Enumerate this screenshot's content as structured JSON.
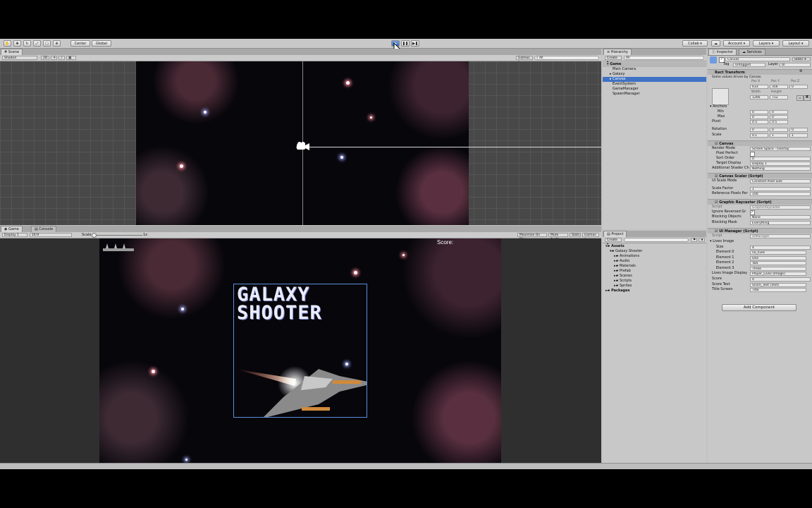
{
  "toolbar": {
    "pivot": "Center",
    "space": "Global",
    "collab": "Collab ▾",
    "account": "Account ▾",
    "layers": "Layers ▾",
    "layout": "Layout ▾"
  },
  "scene": {
    "tab": "Scene",
    "shading": "Shaded",
    "mode_2d": "2D",
    "gizmos": "Gizmos ▾",
    "search": "All"
  },
  "game": {
    "tabs": [
      "Game",
      "Console"
    ],
    "display": "Display 1",
    "aspect": "16:9",
    "scale_label": "Scale",
    "scale_value": "1x",
    "options": [
      "Maximize On Play",
      "Mute Audio",
      "Stats",
      "Gizmos ▾"
    ],
    "score_label": "Score:",
    "title_line1": "GALAXY",
    "title_line2": "SHOOTER"
  },
  "hierarchy": {
    "tab": "Hierarchy",
    "create": "Create ▾",
    "search": "All",
    "scene_name": "Game",
    "items": [
      "Main Camera",
      "Galaxy",
      "Canvas",
      "EventSystem",
      "GameManager",
      "SpawnManager"
    ],
    "selected": "Canvas"
  },
  "project": {
    "tab": "Project",
    "create": "Create ▾",
    "assets": "Assets",
    "folder": "Galaxy Shooter",
    "subfolders": [
      "Animations",
      "Audio",
      "Materials",
      "Prefab",
      "Scenes",
      "Scripts",
      "Sprites"
    ],
    "packages": "Packages"
  },
  "inspector": {
    "tabs": [
      "Inspector",
      "Services"
    ],
    "object_name": "Canvas",
    "static": "Static ▾",
    "tag_label": "Tag",
    "tag": "Untagged",
    "layer_label": "Layer",
    "layer": "UI",
    "rect_transform": {
      "title": "Rect Transform",
      "note": "Some values driven by Canvas.",
      "pos_labels": [
        "Pos X",
        "Pos Y",
        "Pos Z"
      ],
      "pos_values": [
        "633",
        "356",
        "0"
      ],
      "size_labels": [
        "Width",
        "Height"
      ],
      "size_values": [
        "1266",
        "712"
      ],
      "anchors": "Anchors",
      "min": {
        "label": "Min",
        "x": "0",
        "y": "0"
      },
      "max": {
        "label": "Max",
        "x": "0",
        "y": "0"
      },
      "pivot": {
        "label": "Pivot",
        "x": "0.5",
        "y": "0.5"
      },
      "rotation": {
        "label": "Rotation",
        "x": "0",
        "y": "0",
        "z": "0"
      },
      "scale": {
        "label": "Scale",
        "x": "0.1",
        "y": "1",
        "z": "1"
      }
    },
    "canvas": {
      "title": "Canvas",
      "render_mode_label": "Render Mode",
      "render_mode": "Screen Space - Overlay",
      "pixel_perfect_label": "Pixel Perfect",
      "sort_order_label": "Sort Order",
      "sort_order": "0",
      "target_display_label": "Target Display",
      "target_display": "Display 1",
      "shader_label": "Additional Shader Ch",
      "shader": "Nothing"
    },
    "canvas_scaler": {
      "title": "Canvas Scaler (Script)",
      "scale_mode_label": "UI Scale Mode",
      "scale_mode": "Constant Pixel Size",
      "scale_factor_label": "Scale Factor",
      "scale_factor": "1",
      "ref_pixels_label": "Reference Pixels Per",
      "ref_pixels": "100"
    },
    "raycaster": {
      "title": "Graphic Raycaster (Script)",
      "script_label": "Script",
      "script": "GraphicRaycaster",
      "ignore_label": "Ignore Reversed Gr",
      "blocking_objects_label": "Blocking Objects",
      "blocking_objects": "None",
      "blocking_mask_label": "Blocking Mask",
      "blocking_mask": "Everything"
    },
    "ui_manager": {
      "title": "UI Manager (Script)",
      "script_label": "Script",
      "script": "UIManager",
      "lives_label": "Lives Image",
      "size_label": "Size",
      "size": "4",
      "elements": [
        {
          "label": "Element 0",
          "value": "no_lives"
        },
        {
          "label": "Element 1",
          "value": "One"
        },
        {
          "label": "Element 2",
          "value": "Two"
        },
        {
          "label": "Element 3",
          "value": "Three"
        }
      ],
      "lives_display_label": "Lives Image Display",
      "lives_display": "Player_Lives (Image)",
      "score_label": "Score",
      "score": "0",
      "score_text_label": "Score Text",
      "score_text": "Score_Text (Text)",
      "title_screen_label": "Title Screen",
      "title_screen": "Title"
    },
    "add_component": "Add Component"
  }
}
